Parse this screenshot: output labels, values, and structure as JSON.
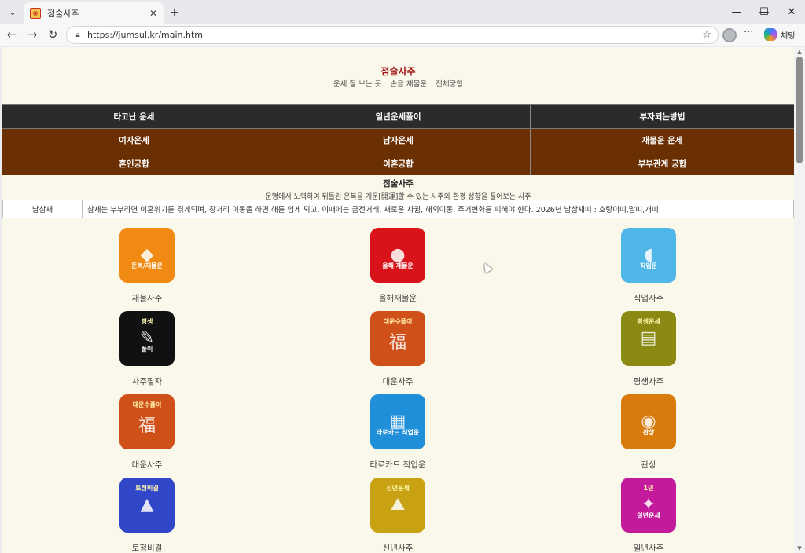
{
  "browser": {
    "tab_title": "점술사주",
    "url": "https://jumsul.kr/main.htm",
    "chat_label": "채팅",
    "close_tab": "✕",
    "new_tab": "+",
    "minimize": "—",
    "maximize": "☐",
    "close_window": "✕",
    "back": "←",
    "forward": "→",
    "reload": "↻",
    "more": "···",
    "tab_list": "⌄"
  },
  "site": {
    "title": "점술사주",
    "links": [
      "운세 잘 보는 곳",
      "손금 재물운",
      "전체궁합"
    ]
  },
  "menu": {
    "rows": [
      {
        "style": "dark",
        "items": [
          "타고난 운세",
          "일년운세풀이",
          "부자되는방법"
        ]
      },
      {
        "style": "brown",
        "items": [
          "여자운세",
          "남자운세",
          "재물운 운세"
        ]
      },
      {
        "style": "brown",
        "items": [
          "혼인궁합",
          "이혼궁합",
          "부부관계 궁합"
        ]
      }
    ]
  },
  "intro": {
    "title": "점술사주",
    "description": "운명에서 노력하여 뒤틀린 운복을 개운[開運]할 수 있는 사주와 환경 성향을 풀어보는 사주"
  },
  "notice": {
    "label": "남삼재",
    "text": "삼재는 부부라면 이혼위기를 겪게되며, 장거리 이동을 하면 해를 입게 되고, 이때에는 금전거래, 새로운 사귐, 해외이동, 주거변화를 피해야 한다. 2026년 남삼재띠 : 호랑이띠,말띠,개띠"
  },
  "cards": [
    {
      "label": "재물사주",
      "tile_caption": "돈복/재물운",
      "tile_top": "",
      "color": "#f08a12",
      "icon": "money-bag-icon"
    },
    {
      "label": "올해재물운",
      "tile_caption": "올해 재물운",
      "tile_top": "",
      "color": "#d8141a",
      "icon": "gold-pig-icon"
    },
    {
      "label": "직업사주",
      "tile_caption": "직업운",
      "tile_top": "",
      "color": "#4fb6e8",
      "icon": "mouse-icon"
    },
    {
      "label": "사주팔자",
      "tile_caption": "풀이",
      "tile_top": "평생",
      "color": "#111111",
      "icon": "calligraphy-icon"
    },
    {
      "label": "대운사주",
      "tile_caption": "",
      "tile_top": "대운수풀이",
      "color": "#d0501a",
      "icon": "fortune-character-icon"
    },
    {
      "label": "평생사주",
      "tile_caption": "",
      "tile_top": "평생운세",
      "color": "#8a8a12",
      "icon": "books-icon"
    },
    {
      "label": "대운사주",
      "tile_caption": "",
      "tile_top": "대운수풀이",
      "color": "#d0501a",
      "icon": "fortune-character-icon"
    },
    {
      "label": "타로카드 직업운",
      "tile_caption": "타로카드 직업운",
      "tile_top": "",
      "color": "#1e8fd8",
      "icon": "tarot-cards-icon"
    },
    {
      "label": "관상",
      "tile_caption": "관상",
      "tile_top": "",
      "color": "#d97a0c",
      "icon": "eye-icon"
    },
    {
      "label": "토정비결",
      "tile_caption": "",
      "tile_top": "토정비결",
      "color": "#2f47c8",
      "icon": "sage-icon"
    },
    {
      "label": "신년사주",
      "tile_caption": "",
      "tile_top": "신년운세",
      "color": "#c9a214",
      "icon": "landscape-icon"
    },
    {
      "label": "일년사주",
      "tile_caption": "일년운세",
      "tile_top": "1년",
      "color": "#c21a9a",
      "icon": "one-year-icon"
    }
  ]
}
